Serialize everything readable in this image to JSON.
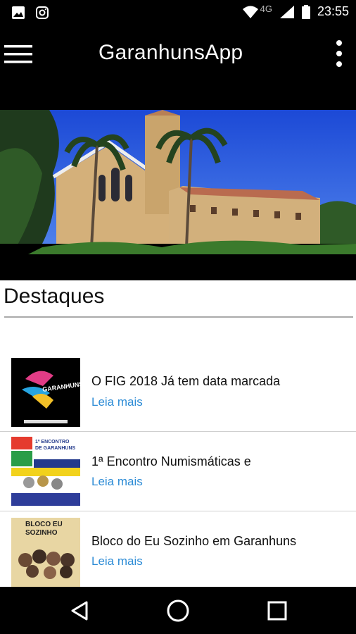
{
  "status": {
    "time": "23:55",
    "network": "4G"
  },
  "appbar": {
    "title": "GaranhunsApp"
  },
  "section": {
    "title": "Destaques"
  },
  "items": [
    {
      "title": "O FIG 2018 Já tem data marcada",
      "link": "Leia mais"
    },
    {
      "title": "1ª Encontro Numismáticas e",
      "link": "Leia mais"
    },
    {
      "title": "Bloco do Eu Sozinho em Garanhuns",
      "link": "Leia mais"
    }
  ],
  "thumbs": {
    "t1": {
      "heading": "GARANHUNS"
    },
    "t2": {
      "heading": "1º ENCONTRO DE GARANHUNS"
    },
    "t3": {
      "heading": "BLOCO EU SOZINHO"
    }
  }
}
